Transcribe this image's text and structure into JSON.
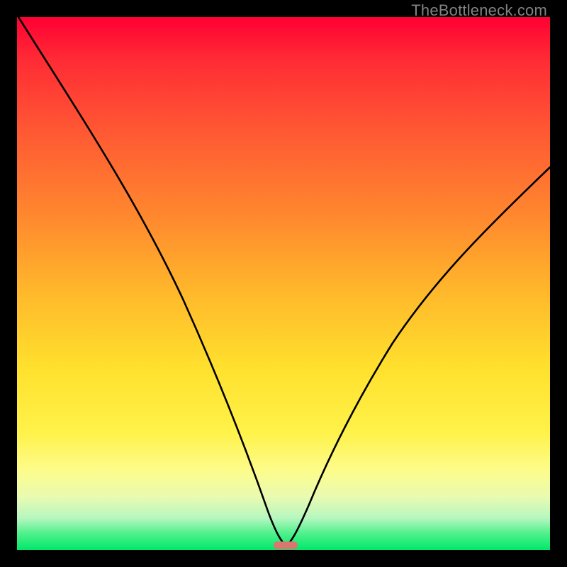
{
  "watermark": "TheBottleneck.com",
  "chart_data": {
    "type": "line",
    "title": "",
    "xlabel": "",
    "ylabel": "",
    "xlim": [
      0,
      100
    ],
    "ylim": [
      0,
      100
    ],
    "grid": false,
    "legend": false,
    "background_gradient": {
      "direction": "vertical",
      "stops": [
        {
          "pos": 0,
          "color": "#ff0033"
        },
        {
          "pos": 22,
          "color": "#ff5a33"
        },
        {
          "pos": 52,
          "color": "#ffb92b"
        },
        {
          "pos": 78,
          "color": "#fff24a"
        },
        {
          "pos": 90,
          "color": "#e9fbb0"
        },
        {
          "pos": 100,
          "color": "#00e86b"
        }
      ]
    },
    "series": [
      {
        "name": "bottleneck-curve",
        "description": "V-shaped curve; steep descending left arm from top-left, trough near x≈50 at y≈0, rising right arm to upper-right",
        "x": [
          0,
          5,
          10,
          15,
          20,
          25,
          30,
          35,
          40,
          45,
          48,
          50,
          52,
          55,
          60,
          65,
          70,
          75,
          80,
          85,
          90,
          95,
          100
        ],
        "y": [
          100,
          96,
          91,
          86,
          80,
          73,
          65,
          54,
          40,
          20,
          6,
          1,
          4,
          12,
          25,
          36,
          45,
          52,
          58,
          63,
          67,
          70,
          72
        ]
      }
    ],
    "markers": [
      {
        "name": "trough-marker",
        "shape": "pill",
        "color": "#d9776e",
        "x": 50,
        "y": 0.5,
        "width_pct": 4,
        "height_pct": 1.5
      }
    ]
  }
}
